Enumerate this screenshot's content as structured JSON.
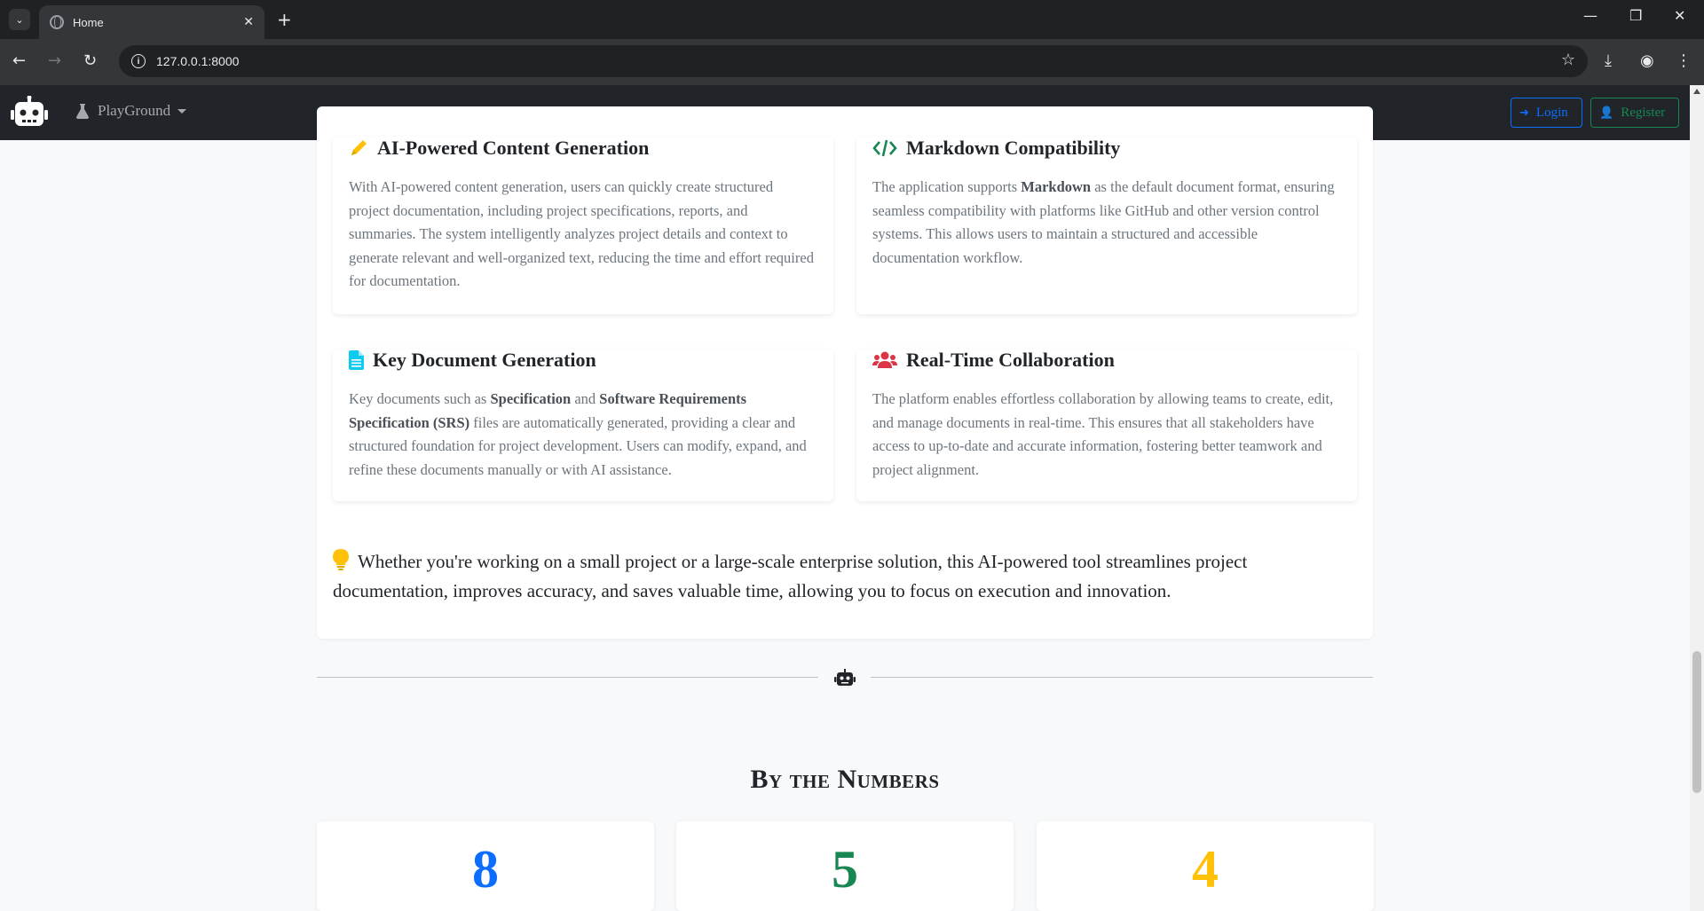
{
  "browser": {
    "tab_title": "Home",
    "url": "127.0.0.1:8000",
    "icons": [
      "tab-list-icon",
      "globe-icon",
      "close-icon",
      "plus-icon",
      "minimize-icon",
      "restore-icon",
      "close-window-icon",
      "back-icon",
      "forward-icon",
      "reload-icon",
      "site-info-icon",
      "star-icon",
      "download-icon",
      "profile-icon",
      "menu-icon"
    ]
  },
  "navbar": {
    "dropdown_label": "PlayGround",
    "login_label": "Login",
    "register_label": "Register",
    "colors": {
      "bg": "#212529",
      "login": "#0d6efd",
      "register": "#198754"
    }
  },
  "features": [
    {
      "title": "AI-Powered Content Generation",
      "icon": "pencil-icon",
      "icon_color": "#ffc107",
      "text": "With AI-powered content generation, users can quickly create structured project documentation, including project specifications, reports, and summaries. The system intelligently analyzes project details and context to generate relevant and well-organized text, reducing the time and effort required for documentation."
    },
    {
      "title": "Markdown Compatibility",
      "icon": "code-icon",
      "icon_color": "#198754",
      "text_before": "The application supports ",
      "text_bold": "Markdown",
      "text_after": " as the default document format, ensuring seamless compatibility with platforms like GitHub and other version control systems. This allows users to maintain a structured and accessible documentation workflow."
    },
    {
      "title": "Key Document Generation",
      "icon": "file-icon",
      "icon_color": "#0dcaf0",
      "text_1": "Key documents such as ",
      "bold_1": "Specification",
      "text_2": " and ",
      "bold_2": "Software Requirements Specification (SRS)",
      "text_3": " files are automatically generated, providing a clear and structured foundation for project development. Users can modify, expand, and refine these documents manually or with AI assistance."
    },
    {
      "title": "Real-Time Collaboration",
      "icon": "users-icon",
      "icon_color": "#dc3545",
      "text": "The platform enables effortless collaboration by allowing teams to create, edit, and manage documents in real-time. This ensures that all stakeholders have access to up-to-date and accurate information, fostering better teamwork and project alignment."
    }
  ],
  "closing_text": "Whether you're working on a small project or a large-scale enterprise solution, this AI-powered tool streamlines project documentation, improves accuracy, and saves valuable time, allowing you to focus on execution and innovation.",
  "section_title": "By the Numbers",
  "stats": [
    {
      "value": "8",
      "color": "#0d6efd"
    },
    {
      "value": "5",
      "color": "#198754"
    },
    {
      "value": "4",
      "color": "#ffc107"
    }
  ]
}
